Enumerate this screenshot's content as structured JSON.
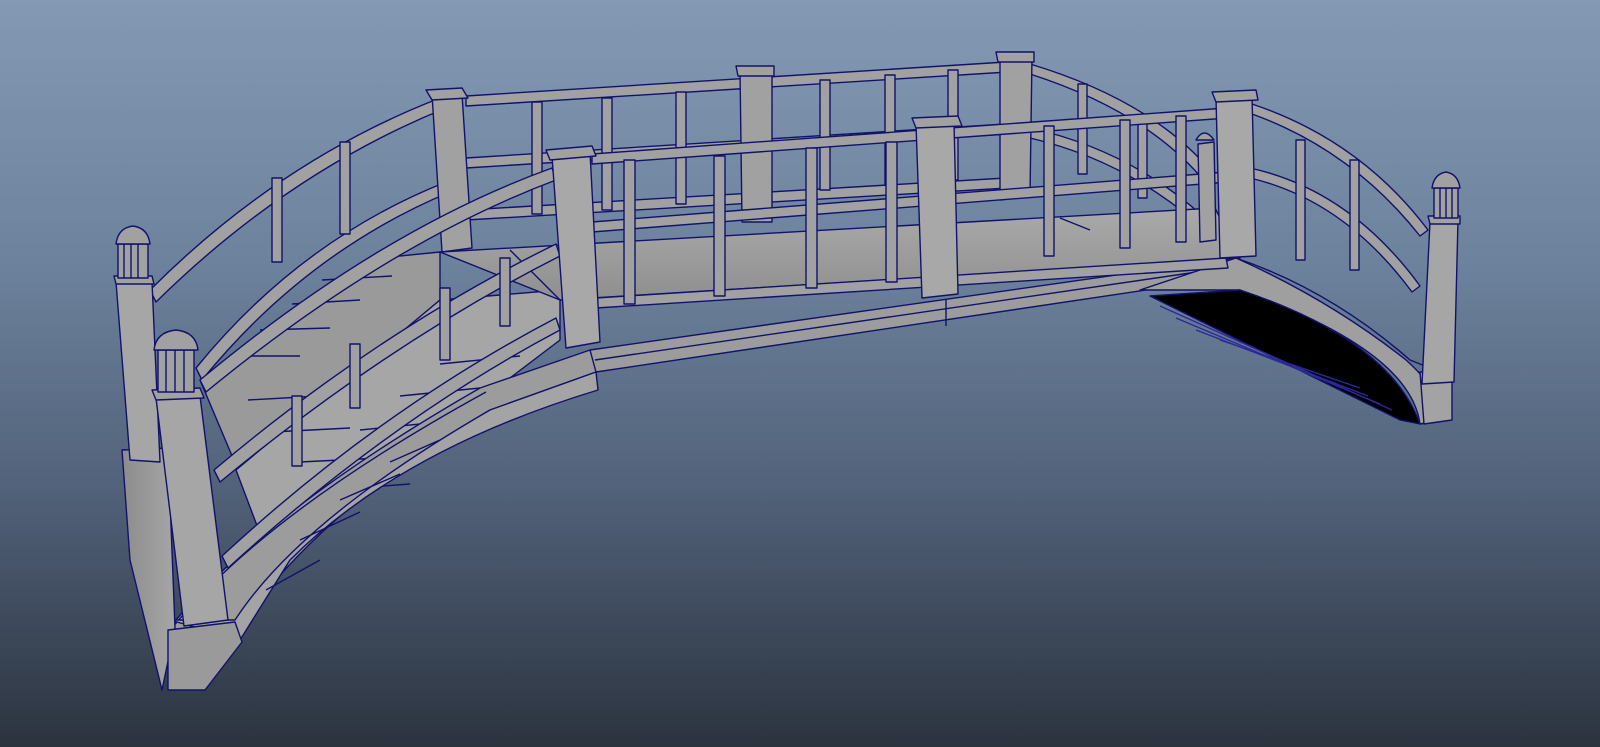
{
  "viewport": {
    "background_top": "#8499b3",
    "background_bottom": "#2b333f",
    "object_fill": "#a1a1a1",
    "wireframe_color": "#10126b",
    "shadow_fill": "#000000"
  },
  "scene_object": {
    "kind": "arched-bridge-model",
    "display_mode": "wireframe-on-shaded"
  }
}
